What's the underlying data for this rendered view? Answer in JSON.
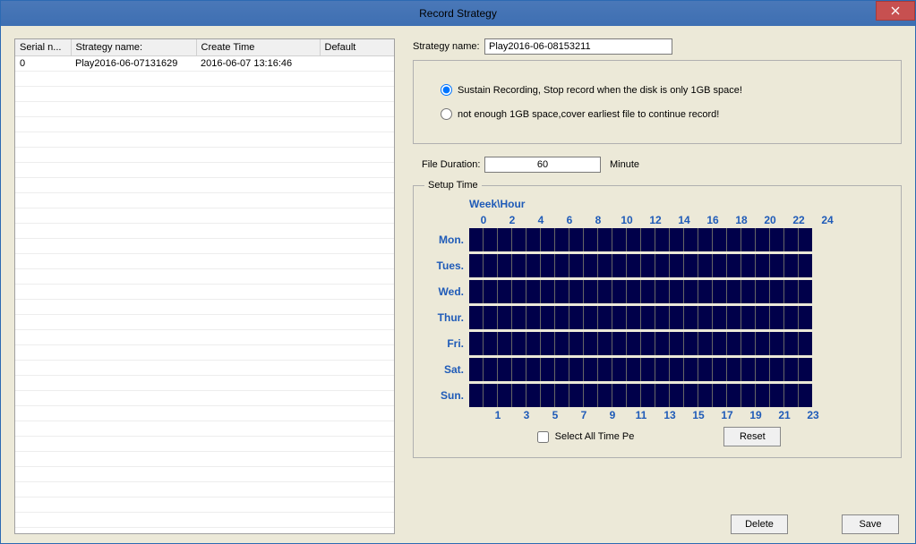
{
  "window": {
    "title": "Record Strategy"
  },
  "table": {
    "headers": {
      "serial": "Serial n...",
      "name": "Strategy name:",
      "time": "Create Time",
      "default": "Default"
    },
    "row": {
      "serial": "0",
      "name": "Play2016-06-07131629",
      "time": "2016-06-07 13:16:46",
      "default": ""
    }
  },
  "form": {
    "strategy_label": "Strategy name:",
    "strategy_value": "Play2016-06-08153211",
    "radio_sustain": "Sustain Recording, Stop record when the disk is only 1GB space!",
    "radio_cover": "not enough 1GB space,cover earliest file to continue record!",
    "duration_label": "File Duration:",
    "duration_value": "60",
    "duration_unit": "Minute"
  },
  "schedule": {
    "legend": "Setup Time",
    "header": "Week\\Hour",
    "top_hours": [
      "0",
      "2",
      "4",
      "6",
      "8",
      "10",
      "12",
      "14",
      "16",
      "18",
      "20",
      "22",
      "24"
    ],
    "bot_hours": [
      "1",
      "3",
      "5",
      "7",
      "9",
      "11",
      "13",
      "15",
      "17",
      "19",
      "21",
      "23"
    ],
    "days": [
      "Mon.",
      "Tues.",
      "Wed.",
      "Thur.",
      "Fri.",
      "Sat.",
      "Sun."
    ],
    "select_all": "Select All Time Pe",
    "reset": "Reset"
  },
  "footer": {
    "delete": "Delete",
    "save": "Save"
  }
}
